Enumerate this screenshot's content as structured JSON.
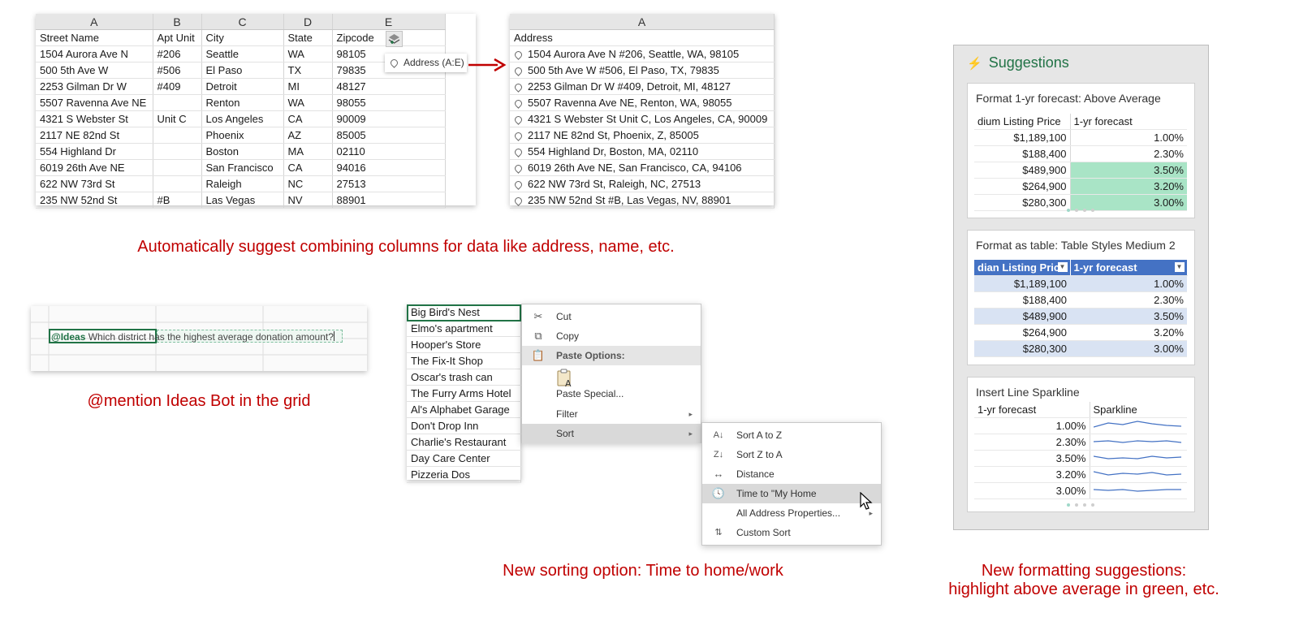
{
  "combine": {
    "col_letters": [
      "A",
      "B",
      "C",
      "D",
      "E"
    ],
    "headers": [
      "Street Name",
      "Apt Unit",
      "City",
      "State",
      "Zipcode"
    ],
    "rows": [
      [
        "1504 Aurora Ave N",
        "#206",
        "Seattle",
        "WA",
        "98105"
      ],
      [
        "500 5th Ave W",
        "#506",
        "El Paso",
        "TX",
        "79835"
      ],
      [
        "2253 Gilman Dr W",
        "#409",
        "Detroit",
        "MI",
        "48127"
      ],
      [
        "5507 Ravenna Ave NE",
        "",
        "Renton",
        "WA",
        "98055"
      ],
      [
        "4321 S Webster St",
        "Unit C",
        "Los Angeles",
        "CA",
        "90009"
      ],
      [
        "2117 NE 82nd St",
        "",
        "Phoenix",
        "AZ",
        "85005"
      ],
      [
        "554 Highland Dr",
        "",
        "Boston",
        "MA",
        "02110"
      ],
      [
        "6019 26th Ave NE",
        "",
        "San Francisco",
        "CA",
        "94016"
      ],
      [
        "622 NW 73rd St",
        "",
        "Raleigh",
        "NC",
        "27513"
      ],
      [
        "235 NW 52nd St",
        "#B",
        "Las Vegas",
        "NV",
        "88901"
      ]
    ],
    "suggestion_chip": "Address (A:E)"
  },
  "combined": {
    "col_letter": "A",
    "header": "Address",
    "rows": [
      "1504 Aurora Ave N #206, Seattle, WA, 98105",
      "500 5th Ave W #506, El Paso, TX, 79835",
      "2253 Gilman Dr W #409, Detroit, MI, 48127",
      "5507 Ravenna Ave NE, Renton, WA, 98055",
      "4321 S Webster St Unit C, Los Angeles, CA, 90009",
      "2117 NE 82nd St, Phoenix, Z, 85005",
      "554 Highland Dr, Boston, MA, 02110",
      "6019 26th Ave NE, San Francisco, CA, 94106",
      "622 NW 73rd St, Raleigh, NC, 27513",
      "235 NW 52nd St #B, Las Vegas, NV, 88901"
    ]
  },
  "captions": {
    "combine": "Automatically suggest combining columns for data like address, name, etc.",
    "ideas": "@mention Ideas Bot in the grid",
    "sort": "New sorting option: Time to home/work",
    "format_line1": "New formatting suggestions:",
    "format_line2": "highlight above average in green, etc."
  },
  "ideas_cell": {
    "mention": "@Ideas",
    "question": "Which district has the highest average donation amount?"
  },
  "places": [
    "Big Bird's Nest",
    "Elmo's apartment",
    "Hooper's Store",
    "The Fix-It Shop",
    "Oscar's trash can",
    "The Furry Arms Hotel",
    "Al's Alphabet Garage",
    "Don't Drop Inn",
    "Charlie's Restaurant",
    "Day Care Center",
    "Pizzeria Dos"
  ],
  "context_menu": {
    "cut": "Cut",
    "copy": "Copy",
    "paste_options": "Paste Options:",
    "paste_special": "Paste Special...",
    "filter": "Filter",
    "sort": "Sort"
  },
  "sort_menu": {
    "a_to_z": "Sort A to Z",
    "z_to_a": "Sort Z to A",
    "distance": "Distance",
    "time_to": "Time to \"My Home",
    "all_props": "All Address Properties...",
    "custom": "Custom Sort"
  },
  "suggestions": {
    "title": "Suggestions",
    "accent_color": "#217346",
    "highlight_color": "#a9e4c6",
    "card1": {
      "title": "Format 1-yr forecast: Above Average",
      "headers": [
        "dium Listing Price",
        "1-yr forecast"
      ],
      "rows": [
        [
          "$1,189,100",
          "1.00%"
        ],
        [
          "$188,400",
          "2.30%"
        ],
        [
          "$489,900",
          "3.50%"
        ],
        [
          "$264,900",
          "3.20%"
        ],
        [
          "$280,300",
          "3.00%"
        ]
      ],
      "above_average": [
        false,
        false,
        true,
        true,
        true
      ]
    },
    "card2": {
      "title": "Format as table: Table Styles Medium 2",
      "header_color": "#4472c4",
      "band_color": "#d9e3f3",
      "headers": [
        "dian Listing Price",
        "1-yr forecast"
      ],
      "rows": [
        [
          "$1,189,100",
          "1.00%"
        ],
        [
          "$188,400",
          "2.30%"
        ],
        [
          "$489,900",
          "3.50%"
        ],
        [
          "$264,900",
          "3.20%"
        ],
        [
          "$280,300",
          "3.00%"
        ]
      ]
    },
    "card3": {
      "title": "Insert Line Sparkline",
      "headers": [
        "1-yr forecast",
        "Sparkline"
      ],
      "rows": [
        "1.00%",
        "2.30%",
        "3.50%",
        "3.20%",
        "3.00%"
      ]
    }
  }
}
